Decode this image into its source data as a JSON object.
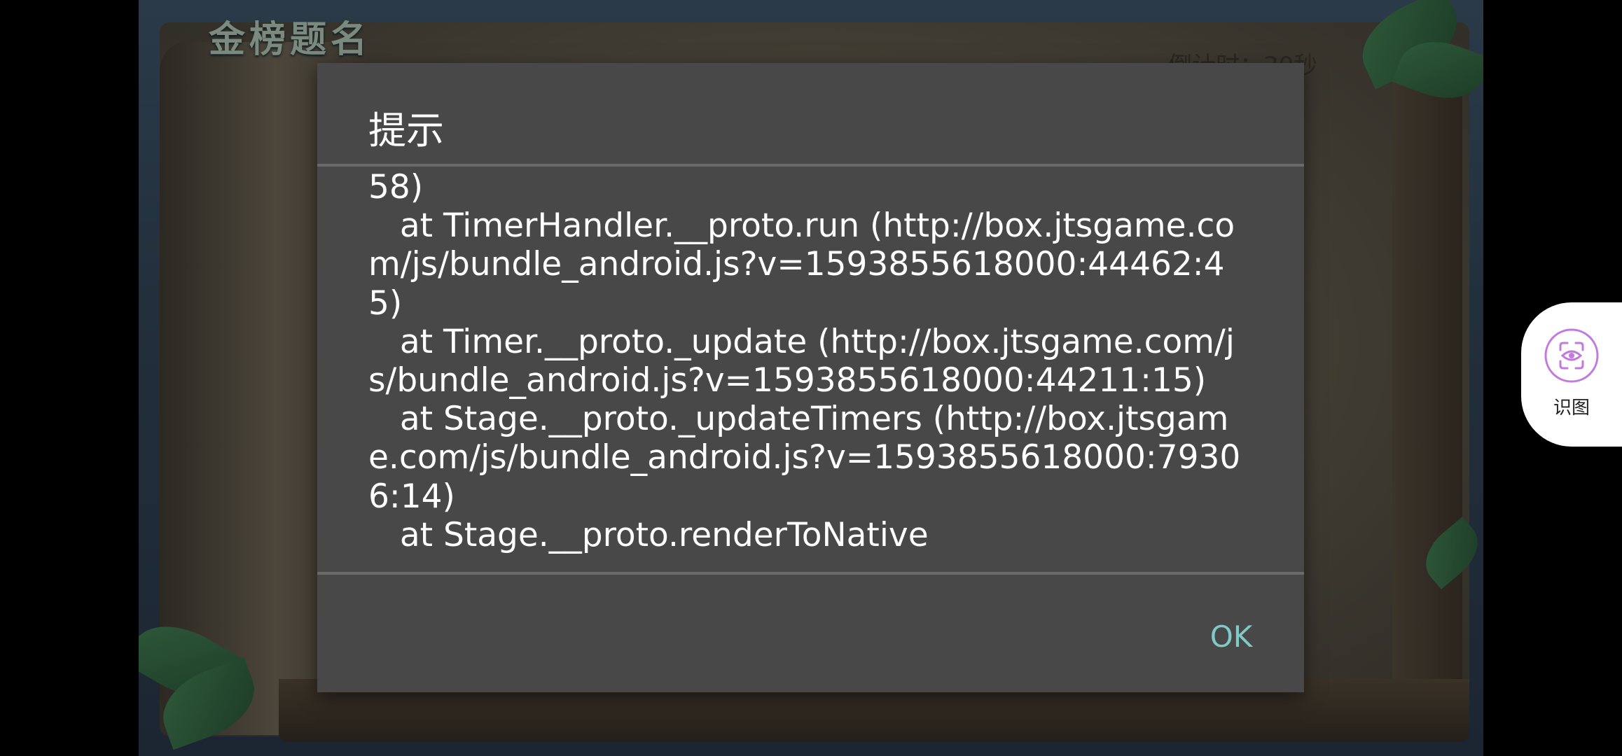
{
  "game": {
    "title": "金榜题名",
    "countdown": "倒计时：30秒"
  },
  "dialog": {
    "title": "提示",
    "message": "58)\n   at TimerHandler.__proto.run (http://box.jtsgame.com/js/bundle_android.js?v=1593855618000:44462:45)\n   at Timer.__proto._update (http://box.jtsgame.com/js/bundle_android.js?v=1593855618000:44211:15)\n   at Stage.__proto._updateTimers (http://box.jtsgame.com/js/bundle_android.js?v=1593855618000:79306:14)\n   at Stage.__proto.renderToNative",
    "ok_label": "OK"
  },
  "side_tool": {
    "label": "识图",
    "icon": "scan-eye-icon",
    "accent": "#c27adf"
  },
  "colors": {
    "dialog_bg": "#484848",
    "ok_text": "#7fcac4"
  }
}
